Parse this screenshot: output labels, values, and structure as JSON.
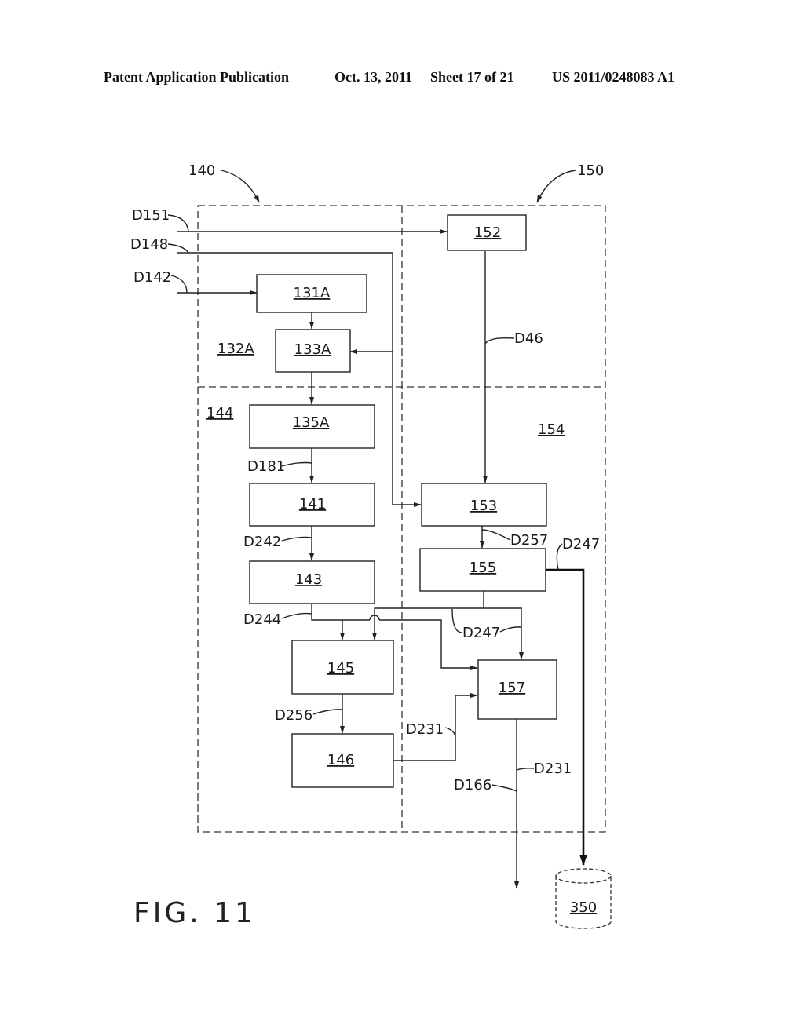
{
  "header": {
    "publication": "Patent Application Publication",
    "date": "Oct. 13, 2011",
    "sheet": "Sheet 17 of 21",
    "number": "US 2011/0248083 A1"
  },
  "figure_label": "FIG. 11",
  "regions": {
    "r140": "140",
    "r150": "150",
    "r132A": "132A",
    "r144": "144",
    "r154": "154"
  },
  "blocks": {
    "b131A": "131A",
    "b133A": "133A",
    "b135A": "135A",
    "b141": "141",
    "b143": "143",
    "b145": "145",
    "b146": "146",
    "b152": "152",
    "b153": "153",
    "b155": "155",
    "b157": "157",
    "b350": "350"
  },
  "signals": {
    "d151": "D151",
    "d148": "D148",
    "d142": "D142",
    "d46": "D46",
    "d181": "D181",
    "d242": "D242",
    "d244": "D244",
    "d257": "D257",
    "d247a": "D247",
    "d247b": "D247",
    "d256": "D256",
    "d231a": "D231",
    "d231b": "D231",
    "d166": "D166"
  }
}
